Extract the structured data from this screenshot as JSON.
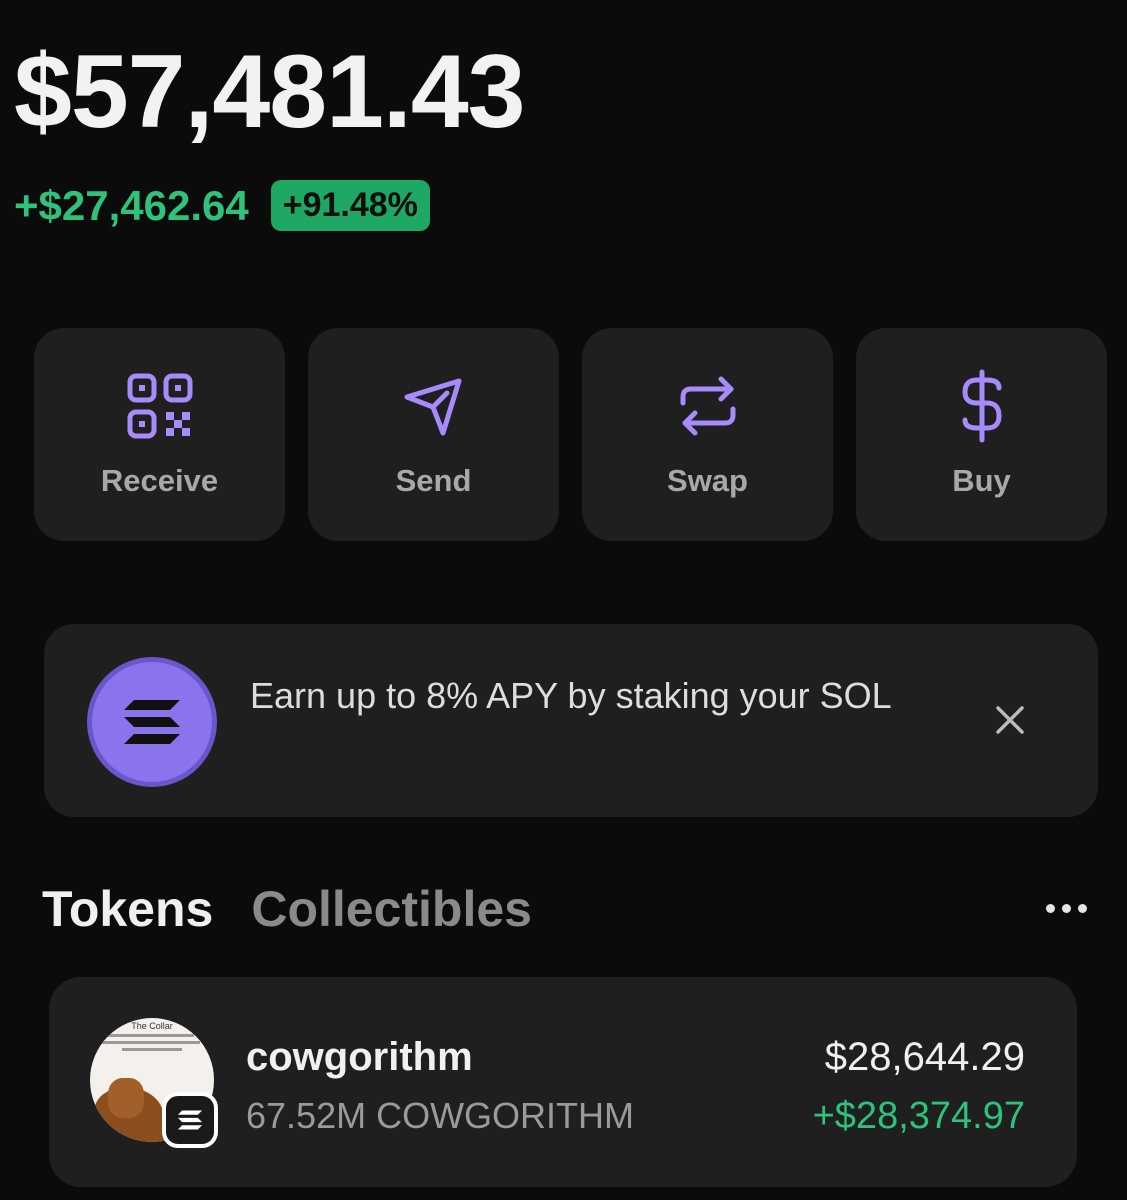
{
  "balance": {
    "total": "$57,481.43",
    "change_amount": "+$27,462.64",
    "change_percent": "+91.48%"
  },
  "actions": [
    {
      "label": "Receive",
      "icon": "qr-code-icon"
    },
    {
      "label": "Send",
      "icon": "send-icon"
    },
    {
      "label": "Swap",
      "icon": "swap-icon"
    },
    {
      "label": "Buy",
      "icon": "dollar-icon"
    }
  ],
  "banner": {
    "text": "Earn up to 8% APY by staking your SOL",
    "icon": "solana-logo-icon",
    "close_icon": "close-icon"
  },
  "tabs": {
    "active": "Tokens",
    "inactive": "Collectibles",
    "more_icon": "more-icon"
  },
  "tokens": [
    {
      "name": "cowgorithm",
      "amount": "67.52M COWGORITHM",
      "value": "$28,644.29",
      "change": "+$28,374.97",
      "avatar_caption": "The Collar"
    }
  ],
  "colors": {
    "accent": "#a78bfa",
    "positive": "#2ec27a",
    "card": "#1f1f1f",
    "background": "#0b0b0b"
  }
}
